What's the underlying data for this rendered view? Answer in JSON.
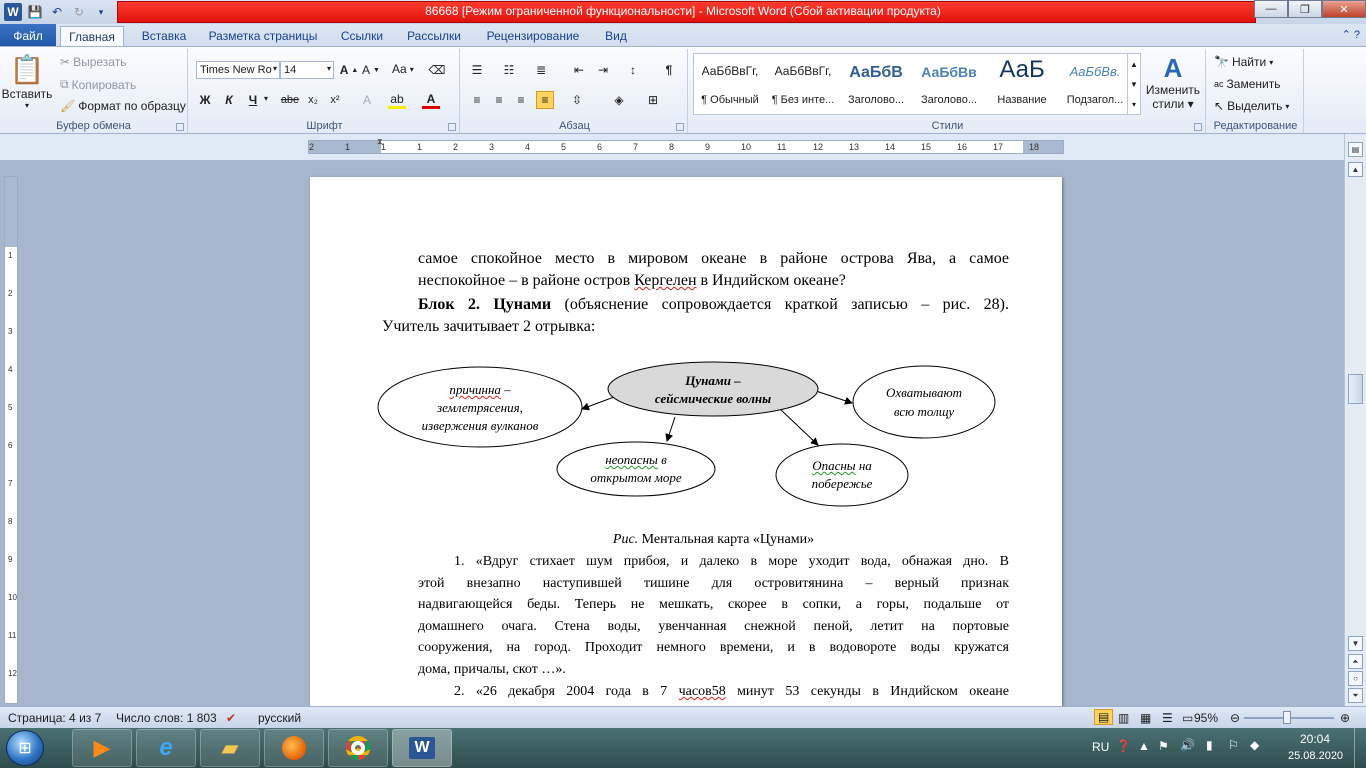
{
  "window": {
    "title": "86668 [Режим ограниченной функциональности]  -  Microsoft Word (Сбой активации продукта)",
    "app_icon": "W"
  },
  "tabs": [
    "Файл",
    "Главная",
    "Вставка",
    "Разметка страницы",
    "Ссылки",
    "Рассылки",
    "Рецензирование",
    "Вид"
  ],
  "active_tab": "Главная",
  "ribbon": {
    "clipboard": {
      "label": "Буфер обмена",
      "paste": "Вставить",
      "cut": "Вырезать",
      "copy": "Копировать",
      "format_painter": "Формат по образцу"
    },
    "font": {
      "label": "Шрифт",
      "font_name": "Times New Ro",
      "font_size": "14",
      "change_case": "Aa",
      "bold": "Ж",
      "italic": "К",
      "underline": "Ч",
      "strike": "abe",
      "subscript": "x₂",
      "superscript": "x²"
    },
    "paragraph": {
      "label": "Абзац"
    },
    "styles": {
      "label": "Стили",
      "items": [
        {
          "preview": "АаБбВвГг,",
          "name": "¶ Обычный"
        },
        {
          "preview": "АаБбВвГг,",
          "name": "¶ Без инте..."
        },
        {
          "preview": "АаБбВ",
          "name": "Заголово..."
        },
        {
          "preview": "АаБбВв",
          "name": "Заголово..."
        },
        {
          "preview": "АаБ",
          "name": "Название"
        },
        {
          "preview": "АаБбВв.",
          "name": "Подзагол..."
        }
      ],
      "change_styles_1": "Изменить",
      "change_styles_2": "стили"
    },
    "editing": {
      "label": "Редактирование",
      "find": "Найти",
      "replace": "Заменить",
      "select": "Выделить"
    }
  },
  "ruler": {
    "ticks": [
      "2",
      "1",
      "1",
      "1",
      "2",
      "3",
      "4",
      "5",
      "6",
      "7",
      "8",
      "9",
      "10",
      "11",
      "12",
      "13",
      "14",
      "15",
      "16",
      "17",
      "18"
    ]
  },
  "vruler": {
    "ticks": [
      "1",
      "2",
      "3",
      "4",
      "5",
      "6",
      "7",
      "8",
      "9",
      "10",
      "11",
      "12"
    ]
  },
  "document": {
    "p1_line1": "самое спокойное место в мировом океане в районе острова Ява, а самое",
    "p1_line2_a": "неспокойное – в районе остров ",
    "p1_line2_b": "Кергелен",
    "p1_line2_c": " в Индийском океане?",
    "p2_bold": "Блок 2. Цунами",
    "p2_rest": " (объяснение сопровождается краткой записью – рис. 28).",
    "p2_line2": "Учитель зачитывает 2 отрывка:",
    "mindmap": {
      "center_1": "Цунами –",
      "center_2": "сейсмические волны",
      "cause_1a": "причинна",
      "cause_1b": " –",
      "cause_2": "землетрясения,",
      "cause_3": "извержения вулканов",
      "safe_1a": "неопасны",
      "safe_1b": " в",
      "safe_2": "открытом море",
      "danger_1a": "Опасны",
      "danger_1b": " на",
      "danger_2": "побережье",
      "whole_1": "Охватывают",
      "whole_2": "всю толщу"
    },
    "caption_italic": "Рис.",
    "caption_rest": " Ментальная карта «Цунами»",
    "q1_lines": [
      "1. «Вдруг стихает шум прибоя, и далеко в море уходит вода, обнажая дно. В",
      "этой внезапно наступившей тишине для островитянина – верный признак",
      "надвигающейся беды. Теперь не мешкать, скорее в сопки, а горы, подальше от",
      "домашнего очага. Стена воды, увенчанная снежной пеной, летит на портовые",
      "сооружения, на город. Проходит немного времени, и в водовороте воды кружатся"
    ],
    "q1_last": "дома, причалы, скот …».",
    "q2_a": "2.  «26 декабря 2004 года в 7 ",
    "q2_b": "часов58",
    "q2_c": " минут 53 секунды в Индийском океане"
  },
  "status": {
    "page": "Страница: 4 из 7",
    "words": "Число слов: 1 803",
    "language": "русский",
    "zoom": "95%",
    "zoom_level": 0.95
  },
  "taskbar": {
    "apps": [
      "media-player",
      "internet-explorer",
      "file-explorer",
      "firefox",
      "chrome",
      "word"
    ],
    "lang": "RU",
    "time": "20:04",
    "date": "25.08.2020"
  }
}
